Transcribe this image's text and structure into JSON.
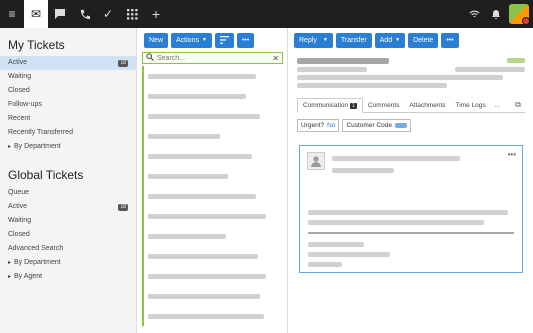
{
  "topbar": {
    "icons": [
      "menu-icon",
      "mail-icon",
      "chat-icon",
      "phone-icon",
      "check-icon",
      "apps-grid-icon",
      "plus-icon"
    ],
    "right_icons": [
      "network-icon",
      "bell-icon",
      "user-avatar"
    ]
  },
  "sidebar": {
    "my_title": "My Tickets",
    "my_items": [
      {
        "label": "Active",
        "badge": "18",
        "active": true
      },
      {
        "label": "Waiting"
      },
      {
        "label": "Closed"
      },
      {
        "label": "Follow-ups"
      },
      {
        "label": "Recent"
      },
      {
        "label": "Recently Transferred"
      },
      {
        "label": "By Department",
        "group": true
      }
    ],
    "global_title": "Global Tickets",
    "global_items": [
      {
        "label": "Queue"
      },
      {
        "label": "Active",
        "badge": "18"
      },
      {
        "label": "Waiting"
      },
      {
        "label": "Closed"
      },
      {
        "label": "Advanced Search"
      },
      {
        "label": "By Department",
        "group": true
      },
      {
        "label": "By Agent",
        "group": true
      }
    ]
  },
  "list": {
    "new_label": "New",
    "actions_label": "Actions",
    "search_placeholder": "Search...",
    "rows": 13
  },
  "detail": {
    "reply_label": "Reply",
    "transfer_label": "Transfer",
    "add_label": "Add",
    "delete_label": "Delete",
    "tabs": [
      {
        "label": "Communication",
        "count": "1",
        "active": true
      },
      {
        "label": "Comments"
      },
      {
        "label": "Attachments"
      },
      {
        "label": "Time Logs"
      }
    ],
    "more_tabs": "...",
    "urgent_label": "Urgent?",
    "urgent_value": "No",
    "customer_code_label": "Customer Code"
  },
  "colors": {
    "primary": "#2a7fd4",
    "topbar": "#1f1f1f",
    "accent_green": "#8bc34a",
    "sidebar_active": "#cfe3f5"
  }
}
